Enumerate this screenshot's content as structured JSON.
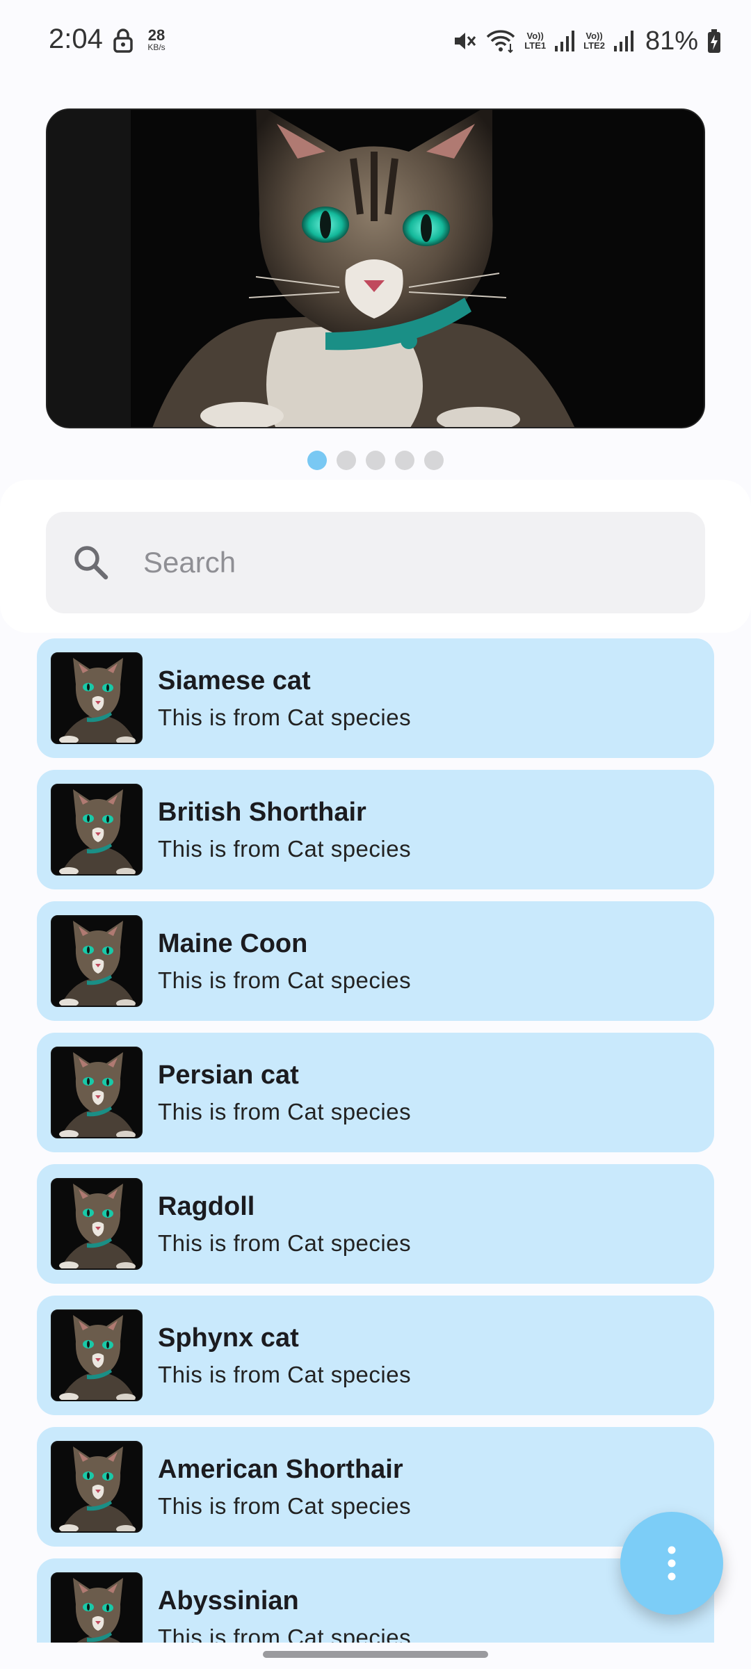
{
  "status_bar": {
    "time": "2:04",
    "net_speed_value": "28",
    "net_speed_unit": "KB/s",
    "sim1_label_top": "Vo))",
    "sim1_label_bottom": "LTE1",
    "sim2_label_top": "Vo))",
    "sim2_label_bottom": "LTE2",
    "battery_percent": "81%"
  },
  "carousel": {
    "slide_count": 5,
    "active_index": 0
  },
  "search": {
    "placeholder": "Search",
    "value": ""
  },
  "list": {
    "items": [
      {
        "title": "Siamese cat",
        "subtitle": "This is from Cat species"
      },
      {
        "title": "British Shorthair",
        "subtitle": "This is from Cat species"
      },
      {
        "title": "Maine Coon",
        "subtitle": "This is from Cat species"
      },
      {
        "title": "Persian cat",
        "subtitle": "This is from Cat species"
      },
      {
        "title": "Ragdoll",
        "subtitle": "This is from Cat species"
      },
      {
        "title": "Sphynx cat",
        "subtitle": "This is from Cat species"
      },
      {
        "title": "American Shorthair",
        "subtitle": "This is from Cat species"
      },
      {
        "title": "Abyssinian",
        "subtitle": "This is from Cat species"
      }
    ]
  },
  "colors": {
    "accent": "#79c8f3",
    "list_item_bg": "#c9e9fc",
    "fab_bg": "#7ccdf7",
    "search_bg": "#f1f1f3"
  },
  "icons": {
    "search": "search-icon",
    "fab": "more-vertical-icon",
    "lock": "lock-icon",
    "mute": "mute-icon",
    "wifi": "wifi-icon",
    "signal": "signal-icon",
    "battery": "battery-charging-icon"
  }
}
